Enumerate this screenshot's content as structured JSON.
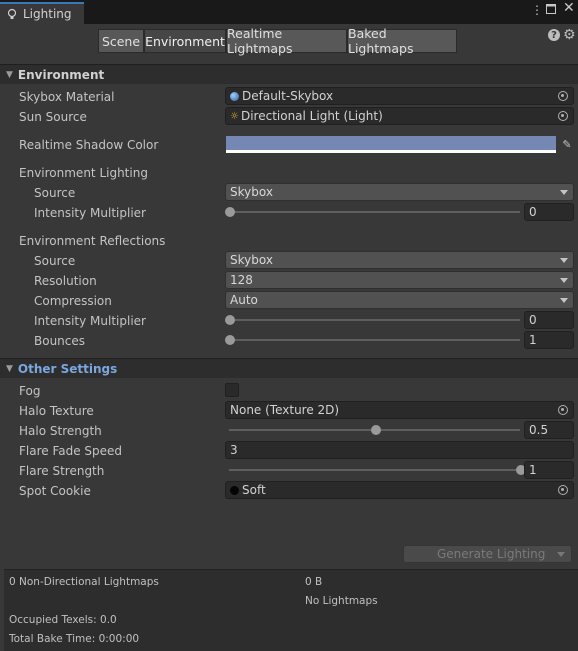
{
  "window": {
    "tab_title": "Lighting",
    "menu_icon": "kebab-menu-icon",
    "maximize_icon": "maximize-icon",
    "close_icon": "close-icon"
  },
  "toolbar": {
    "tabs": [
      "Scene",
      "Environment",
      "Realtime Lightmaps",
      "Baked Lightmaps"
    ],
    "active_tab": "Environment",
    "help_icon": "help-icon",
    "settings_icon": "gear-icon"
  },
  "environment": {
    "header": "Environment",
    "skybox_material": {
      "label": "Skybox Material",
      "value": "Default-Skybox"
    },
    "sun_source": {
      "label": "Sun Source",
      "value": "Directional Light (Light)"
    },
    "shadow_color": {
      "label": "Realtime Shadow Color",
      "color": "#7587b3"
    },
    "env_lighting": {
      "label": "Environment Lighting",
      "source_label": "Source",
      "source_value": "Skybox",
      "intensity_label": "Intensity Multiplier",
      "intensity_value": "0",
      "intensity_fraction": 0.0
    },
    "env_reflections": {
      "label": "Environment Reflections",
      "source_label": "Source",
      "source_value": "Skybox",
      "resolution_label": "Resolution",
      "resolution_value": "128",
      "compression_label": "Compression",
      "compression_value": "Auto",
      "intensity_label": "Intensity Multiplier",
      "intensity_value": "0",
      "intensity_fraction": 0.0,
      "bounces_label": "Bounces",
      "bounces_value": "1",
      "bounces_fraction": 0.0
    }
  },
  "other": {
    "header": "Other Settings",
    "fog": {
      "label": "Fog",
      "checked": false
    },
    "halo_texture": {
      "label": "Halo Texture",
      "value": "None (Texture 2D)"
    },
    "halo_strength": {
      "label": "Halo Strength",
      "value": "0.5",
      "fraction": 0.5
    },
    "flare_fade_speed": {
      "label": "Flare Fade Speed",
      "value": "3"
    },
    "flare_strength": {
      "label": "Flare Strength",
      "value": "1",
      "fraction": 1.0
    },
    "spot_cookie": {
      "label": "Spot Cookie",
      "value": "Soft"
    }
  },
  "generate": {
    "label": "Generate Lighting"
  },
  "stats": {
    "lightmaps": "0 Non-Directional Lightmaps",
    "size": "0 B",
    "no_lightmaps": "No Lightmaps",
    "occupied": "Occupied Texels: 0.0",
    "bake_time": "Total Bake Time: 0:00:00"
  }
}
